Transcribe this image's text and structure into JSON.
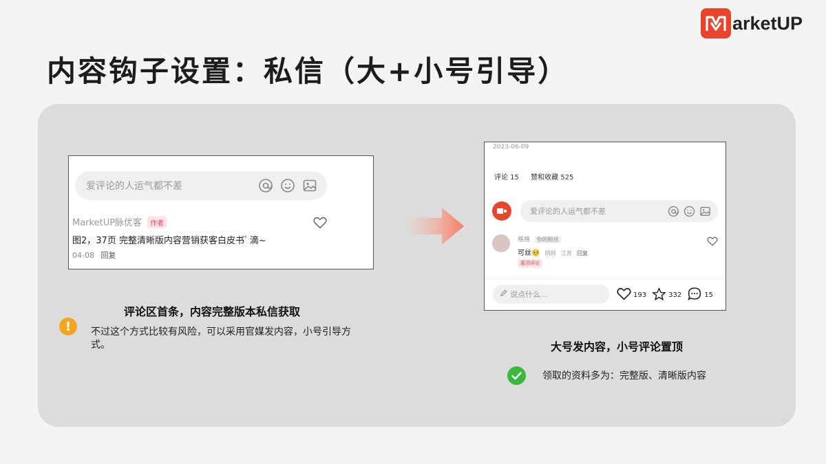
{
  "brand": {
    "name": "arketUP",
    "accent": "#e8452c"
  },
  "slide_title": "内容钩子设置：私信（大+小号引导）",
  "left_screenshot": {
    "input_placeholder": "爱评论的人运气都不差",
    "icons": [
      "at-icon",
      "emoji-icon",
      "image-icon"
    ],
    "comment": {
      "author": "MarketUP脉优客",
      "author_tag": "作者",
      "text": "图2，37页 完整清晰版内容营销获客白皮书",
      "text_suffix": "滴~",
      "date": "04-08",
      "reply": "回复"
    }
  },
  "left_caption": "评论区首条，内容完整版本私信获取",
  "left_note": {
    "icon": "warning-icon",
    "text": "不过这个方式比较有风险，可以采用官媒发内容，小号引导方式。"
  },
  "right_screenshot": {
    "date": "2023-06-09",
    "comments_tab": "评论 15",
    "likes_tab": "赞和收藏 525",
    "input_placeholder": "爱评论的人运气都不差",
    "comment": {
      "user": "格格",
      "user_tag": "你的粉丝",
      "text": "可丝",
      "time": "刚刚",
      "location": "江苏",
      "reply": "回复",
      "pinned_tag": "置顶评论"
    },
    "bottom_bar": {
      "input_placeholder": "说点什么...",
      "likes": "193",
      "favorites": "332",
      "comments": "15"
    }
  },
  "right_caption": "大号发内容，小号评论置顶",
  "right_note": {
    "icon": "check-icon",
    "text": "领取的资料多为：完整版、清晰版内容"
  }
}
